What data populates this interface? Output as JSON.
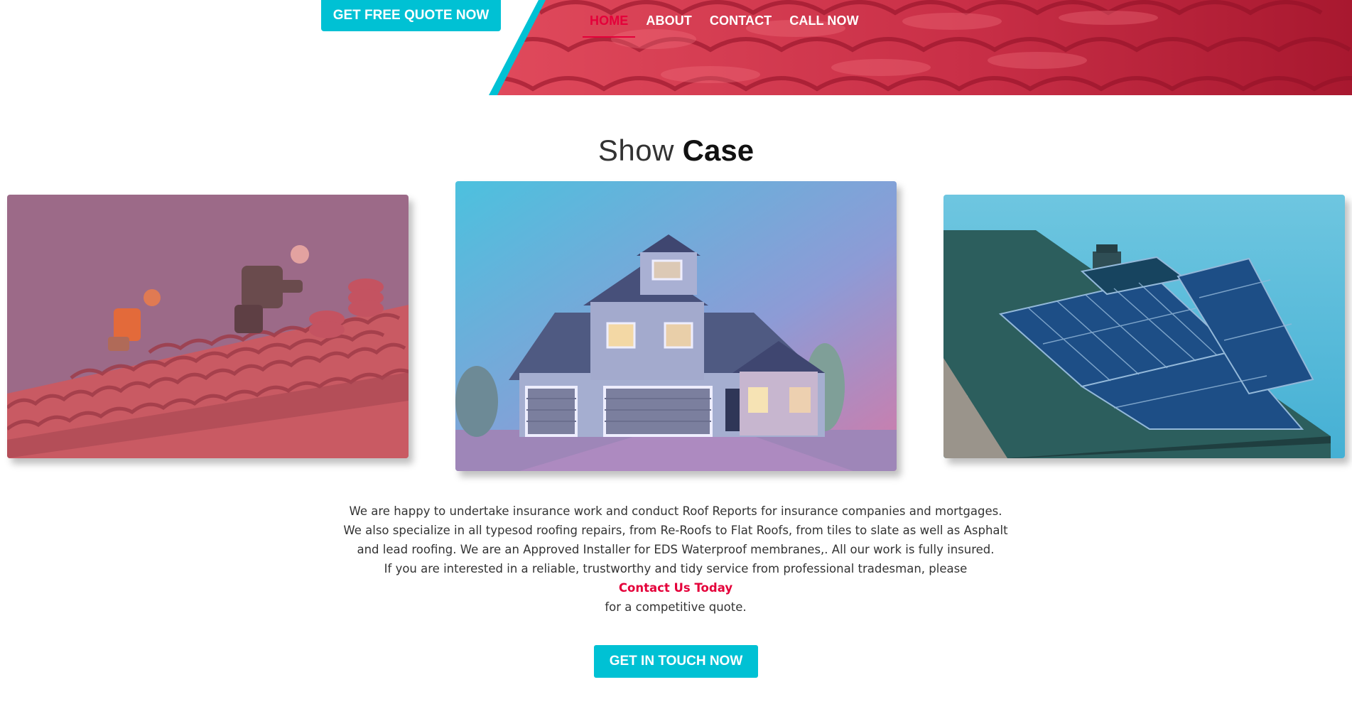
{
  "header": {
    "quote_button": "GET FREE QUOTE NOW",
    "nav": [
      {
        "label": "HOME",
        "active": true
      },
      {
        "label": "ABOUT",
        "active": false
      },
      {
        "label": "CONTACT",
        "active": false
      },
      {
        "label": "CALL NOW",
        "active": false
      }
    ]
  },
  "showcase": {
    "title_light": "Show",
    "title_bold": "Case",
    "images": [
      {
        "subject": "roofers-working-on-tile-roof"
      },
      {
        "subject": "suburban-house"
      },
      {
        "subject": "roof-with-solar-panels"
      }
    ]
  },
  "about": {
    "line1": "We are happy to undertake insurance work and conduct Roof Reports for insurance companies and mortgages.",
    "line2": "We also specialize in all typesod roofing repairs, from Re-Roofs to Flat Roofs, from tiles to slate as well as Asphalt",
    "line3": "and lead roofing. We are an Approved Installer for EDS Waterproof membranes,. All our work is fully insured.",
    "line4": "If you are interested in a reliable, trustworthy and tidy service from professional tradesman, please",
    "contact_link": "Contact Us Today",
    "line5": "for a competitive quote."
  },
  "cta": {
    "touch_button": "GET IN TOUCH NOW"
  },
  "colors": {
    "accent": "#00c1d4",
    "brand_red": "#e4003a",
    "hero_red": "#c2283f"
  }
}
